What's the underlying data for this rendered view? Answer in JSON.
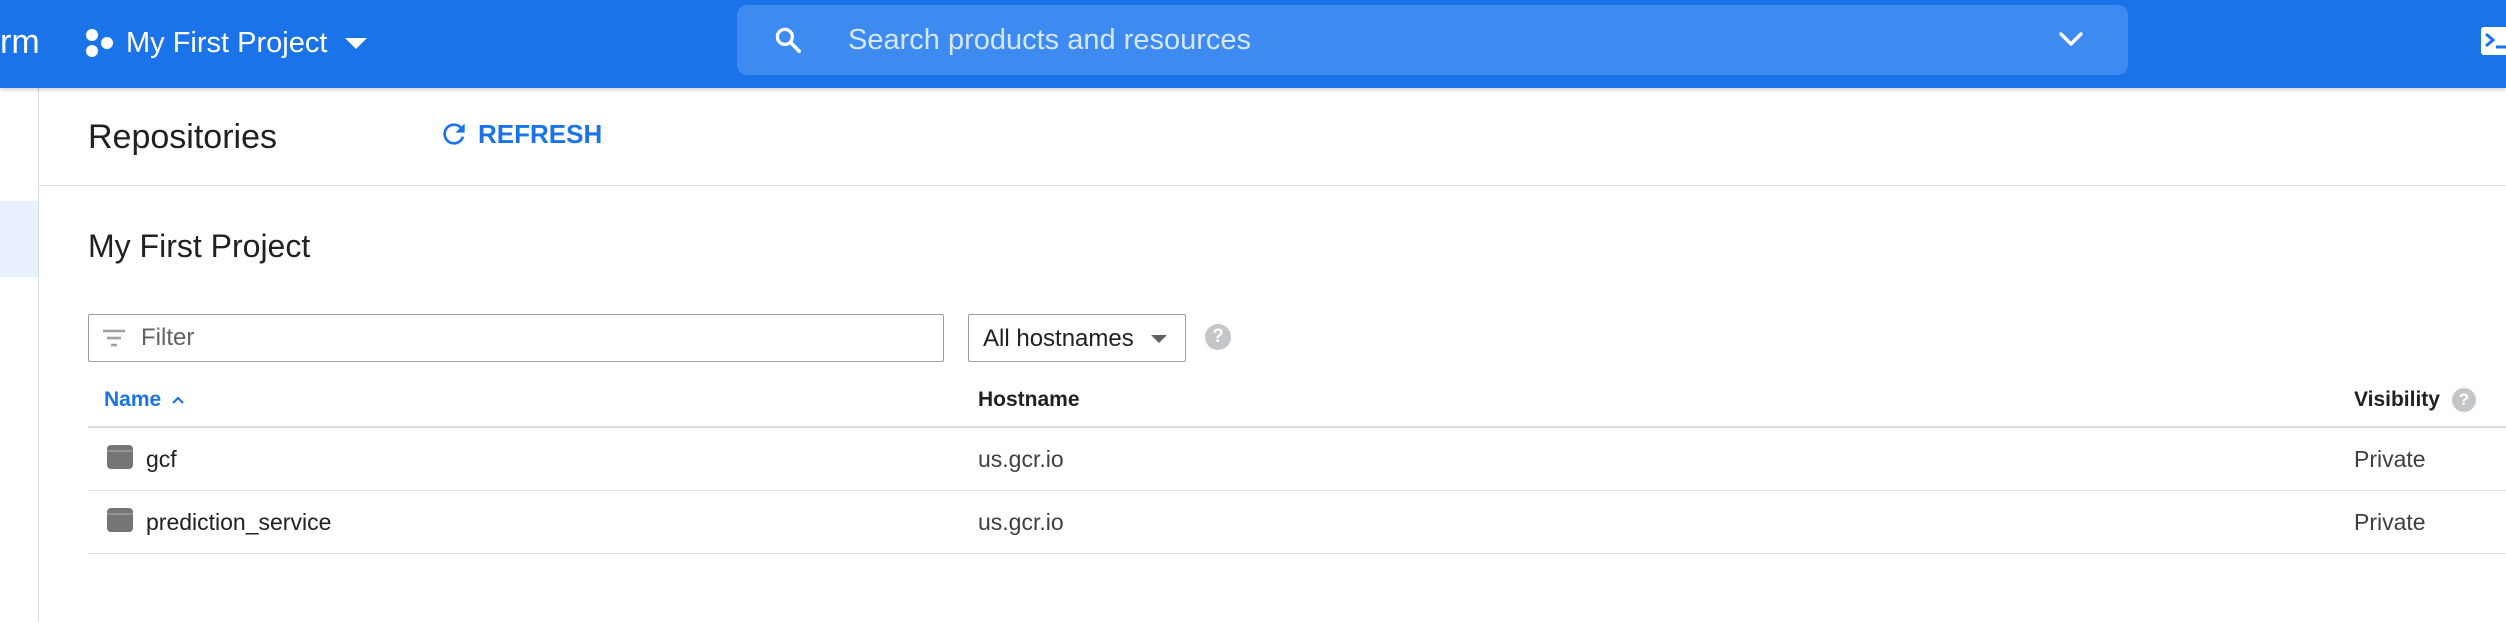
{
  "topbar": {
    "brand_fragment": "rm",
    "project_name": "My First Project",
    "search_placeholder": "Search products and resources"
  },
  "page": {
    "title": "Repositories",
    "refresh_label": "REFRESH",
    "section_title": "My First Project"
  },
  "filter": {
    "placeholder": "Filter",
    "value": ""
  },
  "hostname_select": {
    "selected": "All hostnames"
  },
  "table": {
    "columns": {
      "name": "Name",
      "hostname": "Hostname",
      "visibility": "Visibility"
    },
    "sort": {
      "column": "name",
      "direction": "ascending"
    },
    "rows": [
      {
        "name": "gcf",
        "hostname": "us.gcr.io",
        "visibility": "Private"
      },
      {
        "name": "prediction_service",
        "hostname": "us.gcr.io",
        "visibility": "Private"
      }
    ]
  },
  "colors": {
    "topbar": "#1a73e8",
    "search_bg": "#3d8bf0",
    "accent": "#1a73e8",
    "border": "#dadce0",
    "help_icon": "#c4c7ca",
    "repo_icon": "#757575"
  },
  "icons": {
    "project": "project-dots-icon",
    "search": "search-icon",
    "search_expand": "chevron-down-icon",
    "terminal": "cloud-shell-icon",
    "refresh": "refresh-icon",
    "filter": "filter-icon",
    "help": "help-icon",
    "sort": "sort-ascending-icon",
    "repository": "repository-icon"
  }
}
